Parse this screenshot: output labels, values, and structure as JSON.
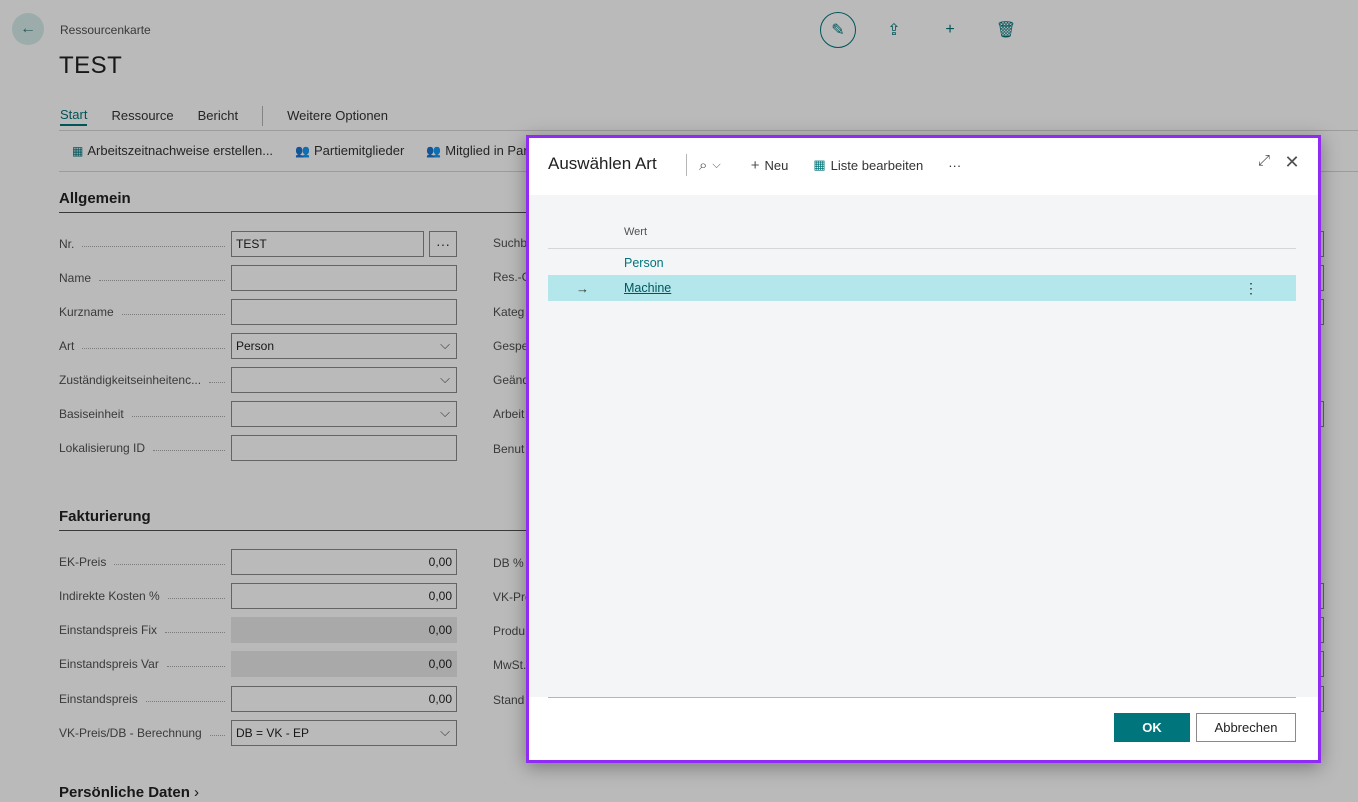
{
  "page": {
    "breadcrumb": "Ressourcenkarte",
    "title": "TEST",
    "back_icon": "arrow-left-icon",
    "top_actions": [
      "edit-icon",
      "share-icon",
      "add-icon",
      "delete-icon"
    ],
    "nav": {
      "start": "Start",
      "ressource": "Ressource",
      "bericht": "Bericht",
      "weitere": "Weitere Optionen"
    },
    "actions": {
      "zeitnachweise": "Arbeitszeitnachweise erstellen...",
      "partiemitglieder": "Partiemitglieder",
      "mitglied": "Mitglied in Parti"
    },
    "allgemein": {
      "heading": "Allgemein",
      "nr_label": "Nr.",
      "nr_value": "TEST",
      "name_label": "Name",
      "kurzname_label": "Kurzname",
      "art_label": "Art",
      "art_value": "Person",
      "zust_label": "Zuständigkeitseinheitenc...",
      "basis_label": "Basiseinheit",
      "lokal_label": "Lokalisierung ID",
      "right_labels": [
        "Suchb",
        "Res.-G",
        "Kateg",
        "Gespe",
        "Geänd",
        "Arbeit",
        "Benut"
      ]
    },
    "fakturierung": {
      "heading": "Fakturierung",
      "ek_label": "EK-Preis",
      "ek_value": "0,00",
      "ind_label": "Indirekte Kosten %",
      "ind_value": "0,00",
      "fix_label": "Einstandspreis Fix",
      "fix_value": "0,00",
      "var_label": "Einstandspreis Var",
      "var_value": "0,00",
      "ep_label": "Einstandspreis",
      "ep_value": "0,00",
      "vk_label": "VK-Preis/DB - Berechnung",
      "vk_value": "DB = VK - EP",
      "right_labels": [
        "DB %",
        "VK-Pre",
        "Produ",
        "MwSt.",
        "Stand"
      ]
    },
    "persoenlich": {
      "heading": "Persönliche Daten"
    }
  },
  "dialog": {
    "title": "Auswählen Art",
    "search_icon": "search-icon",
    "new_label": "Neu",
    "edit_list_label": "Liste bearbeiten",
    "more_label": "···",
    "column_header": "Wert",
    "rows": [
      {
        "value": "Person",
        "selected": false
      },
      {
        "value": "Machine",
        "selected": true
      }
    ],
    "ok_label": "OK",
    "cancel_label": "Abbrechen",
    "accent_color": "#00757b",
    "selection_color": "#b3e7eb",
    "border_color": "#8f2bf4"
  }
}
